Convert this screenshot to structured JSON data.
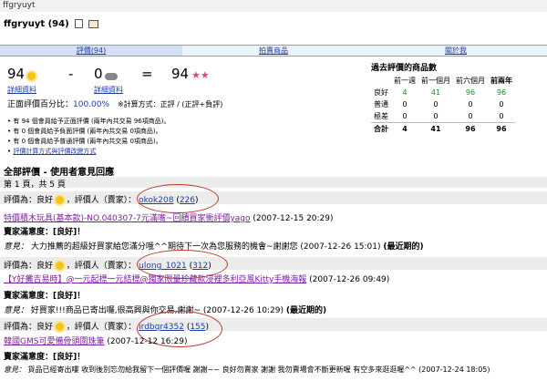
{
  "top_label": "ffgryuyt",
  "title": "ffgryuyt (94)",
  "tabs": [
    {
      "label": "評價(94)"
    },
    {
      "label": "拍賣商品"
    },
    {
      "label": "關於我"
    }
  ],
  "score": {
    "positive": "94",
    "positive_link": "詳細資料",
    "minus": "-",
    "negative": "0",
    "negative_link": "詳細資料",
    "equals": "=",
    "total": "94"
  },
  "percent_label": "正面評價百分比：",
  "percent_value": "100.00%",
  "formula_note": "※計算方式：正評 / (正評+負評)",
  "bullets": [
    "有 94 個會員給予正面評價 (兩年內共交易 96項商品)。",
    "有 0 個會員給予負面評價 (兩年內共交易 0項商品)。",
    "有 0 個會員給予普通評價 (兩年內共交易 0項商品)。",
    "評價計算方式與評價改變方式"
  ],
  "stats": {
    "title": "過去評價的商品數",
    "cols": [
      "前一週",
      "前一個月",
      "前六個月",
      "前兩年"
    ],
    "rows": [
      {
        "label": "良好",
        "values": [
          "4",
          "41",
          "96",
          "96"
        ]
      },
      {
        "label": "普通",
        "values": [
          "0",
          "0",
          "0",
          "0"
        ]
      },
      {
        "label": "極差",
        "values": [
          "0",
          "0",
          "0",
          "0"
        ]
      },
      {
        "label": "合計",
        "values": [
          "4",
          "41",
          "96",
          "96"
        ]
      }
    ]
  },
  "section_title": "全部評價 - 使用者意見回應",
  "paging": "第 1 頁，共 5 頁",
  "entries": [
    {
      "rating_label": "評價為：良好",
      "rater_label": "，評價人（賣家）：",
      "user": "okok208",
      "count": "226",
      "item": "特價積木玩具(基本款)-NO.040307-7元滿嘴~回饋買家衝評價yago",
      "item_time": "(2007-12-15 20:29)",
      "reply_label": "意見：",
      "reply": "大力推薦的超級好買家給您滿分哦^^期待下一次為您服務的機會~謝謝您",
      "reply_time": "(2007-12-26 15:01)",
      "reply_tag": "(最近期的)",
      "satisfaction": "賣家滿意度：[良好]！"
    },
    {
      "rating_label": "評價為：良好",
      "rater_label": "，評價人（賣家）：",
      "user": "ulong_1021",
      "count": "312",
      "item": "【Y好攤吉易時】@一元起標一元結標@獨家限量珍藏款浸裡多利亞風Kitty手機海報",
      "item_time": "(2007-12-26 09:49)",
      "reply_label": "意見：",
      "reply": "好買家!!!商品已寄出囉,很高興與你交易,謝謝~",
      "reply_time": "(2007-12-26 10:29)",
      "reply_tag": "(最近期的)",
      "satisfaction": "賣家滿意度：[良好]！"
    },
    {
      "rating_label": "評價為：良好",
      "rater_label": "，評價人（賣家）：",
      "user": "irdbqr4352",
      "count": "155",
      "item": "韓國GMS可愛備骨頭圍珠筆",
      "item_time": "(2007-12-12 16:29)",
      "reply_label": "意見：",
      "reply": "貨品已經寄出嘍 收到後別忘勿給我留下一個評價喔 謝謝~~ 良好勿賣家 謝謝 我勿賣場會不斷更新喔 有空多來逛逛喔^^",
      "reply_time": "(2007-12-24 18:05)",
      "satisfaction": ""
    }
  ],
  "colors": {
    "accent": "#1e3ea8",
    "tab_bg": "#d4dff3",
    "good": "#1a8c1a",
    "circle": "#c0392b"
  }
}
